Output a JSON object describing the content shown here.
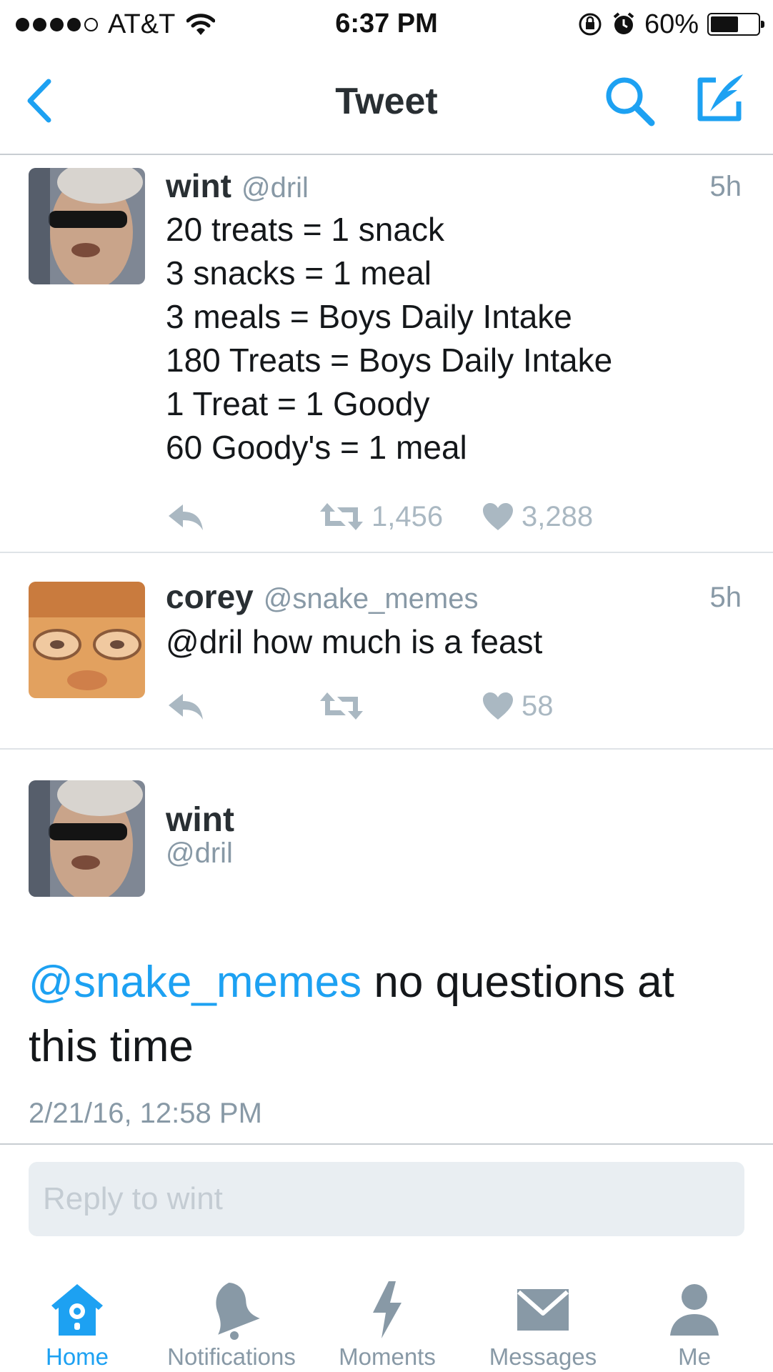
{
  "status_bar": {
    "carrier": "AT&T",
    "time": "6:37 PM",
    "battery_percent": "60%",
    "battery_level": 0.6,
    "signal_bars": 4,
    "icons": [
      "signal-dots-icon",
      "wifi-icon",
      "rotation-lock-icon",
      "alarm-icon",
      "battery-icon"
    ]
  },
  "nav": {
    "title": "Tweet",
    "back_icon": "chevron-left-icon",
    "search_icon": "search-icon",
    "compose_icon": "compose-icon"
  },
  "colors": {
    "accent": "#1da1f2",
    "muted": "#8899a6",
    "action_gray": "#aab8c2"
  },
  "tweets": [
    {
      "name": "wint",
      "handle": "@dril",
      "time": "5h",
      "lines": [
        "20 treats = 1 snack",
        "3 snacks = 1 meal",
        "3 meals = Boys Daily Intake",
        "180 Treats = Boys Daily Intake",
        "1 Treat = 1 Goody",
        "60 Goody's = 1 meal"
      ],
      "retweets": "1,456",
      "likes": "3,288"
    },
    {
      "name": "corey",
      "handle": "@snake_memes",
      "time": "5h",
      "lines": [
        "@dril how much is a feast"
      ],
      "retweets": "",
      "likes": "58"
    }
  ],
  "main_tweet": {
    "name": "wint",
    "handle": "@dril",
    "mention": "@snake_memes",
    "text": " no questions at this time",
    "date": "2/21/16, 12:58 PM"
  },
  "reply": {
    "placeholder": "Reply to wint"
  },
  "tabs": [
    {
      "label": "Home",
      "icon": "home-icon",
      "active": true
    },
    {
      "label": "Notifications",
      "icon": "bell-icon",
      "active": false
    },
    {
      "label": "Moments",
      "icon": "lightning-icon",
      "active": false
    },
    {
      "label": "Messages",
      "icon": "envelope-icon",
      "active": false
    },
    {
      "label": "Me",
      "icon": "person-icon",
      "active": false
    }
  ]
}
